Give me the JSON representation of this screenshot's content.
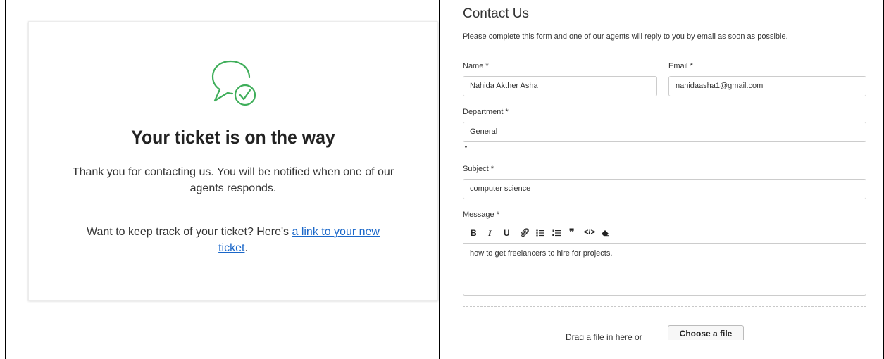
{
  "confirmation": {
    "title": "Your ticket is on the way",
    "message": "Thank you for contacting us. You will be notified when one of our agents responds.",
    "track_prefix": "Want to keep track of your ticket? Here's ",
    "track_link": "a link to your new ticket",
    "track_suffix": ".",
    "icon": "chat-bubble-check-icon",
    "icon_color": "#3fae5a",
    "link_color": "#1a67c9"
  },
  "form": {
    "title": "Contact Us",
    "description": "Please complete this form and one of our agents will reply to you by email as soon as possible.",
    "name_label": "Name *",
    "name_value": "Nahida Akther Asha",
    "email_label": "Email *",
    "email_value": "nahidaasha1@gmail.com",
    "department_label": "Department *",
    "department_value": "General",
    "subject_label": "Subject *",
    "subject_value": "computer science",
    "message_label": "Message *",
    "message_value": "how to get freelancers to hire for projects.",
    "toolbar": {
      "bold": "B",
      "italic": "I",
      "underline": "U",
      "link": "link-icon",
      "bullet_list": "bullet-list-icon",
      "numbered_list": "numbered-list-icon",
      "quote": "quote-icon",
      "code": "code-icon",
      "clear_format": "eraser-icon"
    },
    "drop_text": "Drag a file in here or",
    "choose_file": "Choose a file"
  }
}
